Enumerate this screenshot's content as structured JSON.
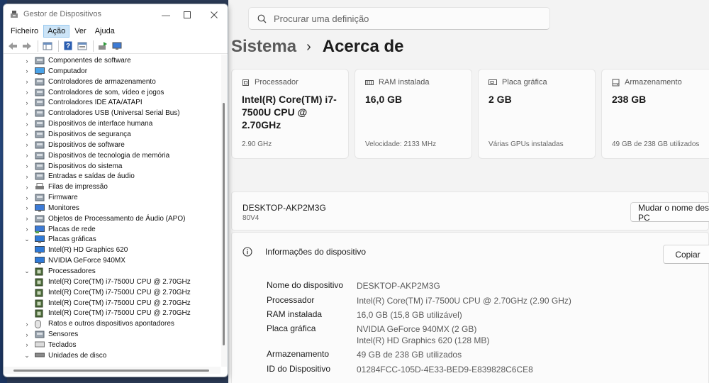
{
  "device_manager": {
    "title": "Gestor de Dispositivos",
    "menu": [
      "Ficheiro",
      "Ação",
      "Ver",
      "Ajuda"
    ],
    "tree": [
      {
        "label": "Componentes de software",
        "level": 0,
        "expanded": false,
        "icon": "software-component-icon"
      },
      {
        "label": "Computador",
        "level": 0,
        "expanded": false,
        "icon": "computer-icon"
      },
      {
        "label": "Controladores de armazenamento",
        "level": 0,
        "expanded": false,
        "icon": "storage-controller-icon"
      },
      {
        "label": "Controladores de som, vídeo e jogos",
        "level": 0,
        "expanded": false,
        "icon": "speaker-icon"
      },
      {
        "label": "Controladores IDE ATA/ATAPI",
        "level": 0,
        "expanded": false,
        "icon": "ide-controller-icon"
      },
      {
        "label": "Controladores USB (Universal Serial Bus)",
        "level": 0,
        "expanded": false,
        "icon": "usb-icon"
      },
      {
        "label": "Dispositivos de interface humana",
        "level": 0,
        "expanded": false,
        "icon": "hid-icon"
      },
      {
        "label": "Dispositivos de segurança",
        "level": 0,
        "expanded": false,
        "icon": "security-device-icon"
      },
      {
        "label": "Dispositivos de software",
        "level": 0,
        "expanded": false,
        "icon": "software-device-icon"
      },
      {
        "label": "Dispositivos de tecnologia de memória",
        "level": 0,
        "expanded": false,
        "icon": "memory-icon"
      },
      {
        "label": "Dispositivos do sistema",
        "level": 0,
        "expanded": false,
        "icon": "system-folder-icon"
      },
      {
        "label": "Entradas e saídas de áudio",
        "level": 0,
        "expanded": false,
        "icon": "audio-io-icon"
      },
      {
        "label": "Filas de impressão",
        "level": 0,
        "expanded": false,
        "icon": "printer-icon"
      },
      {
        "label": "Firmware",
        "level": 0,
        "expanded": false,
        "icon": "firmware-icon"
      },
      {
        "label": "Monitores",
        "level": 0,
        "expanded": false,
        "icon": "monitor-icon"
      },
      {
        "label": "Objetos de Processamento de Áudio (APO)",
        "level": 0,
        "expanded": false,
        "icon": "audio-processing-icon"
      },
      {
        "label": "Placas de rede",
        "level": 0,
        "expanded": false,
        "icon": "network-adapter-icon"
      },
      {
        "label": "Placas gráficas",
        "level": 0,
        "expanded": true,
        "icon": "display-adapter-icon"
      },
      {
        "label": "Intel(R) HD Graphics 620",
        "level": 1,
        "icon": "display-adapter-icon"
      },
      {
        "label": "NVIDIA GeForce 940MX",
        "level": 1,
        "icon": "display-adapter-icon"
      },
      {
        "label": "Processadores",
        "level": 0,
        "expanded": true,
        "icon": "processor-icon"
      },
      {
        "label": "Intel(R) Core(TM) i7-7500U CPU @ 2.70GHz",
        "level": 1,
        "icon": "processor-icon"
      },
      {
        "label": "Intel(R) Core(TM) i7-7500U CPU @ 2.70GHz",
        "level": 1,
        "icon": "processor-icon"
      },
      {
        "label": "Intel(R) Core(TM) i7-7500U CPU @ 2.70GHz",
        "level": 1,
        "icon": "processor-icon"
      },
      {
        "label": "Intel(R) Core(TM) i7-7500U CPU @ 2.70GHz",
        "level": 1,
        "icon": "processor-icon"
      },
      {
        "label": "Ratos e outros dispositivos apontadores",
        "level": 0,
        "expanded": false,
        "icon": "mouse-icon"
      },
      {
        "label": "Sensores",
        "level": 0,
        "expanded": false,
        "icon": "sensor-icon"
      },
      {
        "label": "Teclados",
        "level": 0,
        "expanded": false,
        "icon": "keyboard-icon"
      },
      {
        "label": "Unidades de disco",
        "level": 0,
        "expanded": true,
        "icon": "disk-drive-icon"
      }
    ]
  },
  "settings": {
    "search": {
      "placeholder": "Procurar uma definição"
    },
    "breadcrumb": {
      "parent": "Sistema",
      "current": "Acerca de"
    },
    "cards": [
      {
        "label": "Processador",
        "value": "Intel(R) Core(TM) i7-7500U CPU @ 2.70GHz",
        "sub": "2.90 GHz",
        "icon": "processor-icon"
      },
      {
        "label": "RAM instalada",
        "value": "16,0 GB",
        "sub": "Velocidade: 2133 MHz",
        "icon": "ram-icon"
      },
      {
        "label": "Placa gráfica",
        "value": "2 GB",
        "sub": "Várias GPUs instaladas",
        "icon": "gpu-icon"
      },
      {
        "label": "Armazenamento",
        "value": "238 GB",
        "sub": "49 GB de 238 GB utilizados",
        "icon": "storage-icon"
      }
    ],
    "device": {
      "name": "DESKTOP-AKP2M3G",
      "model": "80V4",
      "rename_label": "Mudar o nome deste PC"
    },
    "info": {
      "title": "Informações do dispositivo",
      "copy_label": "Copiar",
      "specs": [
        {
          "key": "Nome do dispositivo",
          "value": "DESKTOP-AKP2M3G"
        },
        {
          "key": "Processador",
          "value": "Intel(R) Core(TM) i7-7500U CPU @ 2.70GHz (2.90 GHz)"
        },
        {
          "key": "RAM instalada",
          "value": "16,0 GB (15,8 GB utilizável)"
        },
        {
          "key": "Placa gráfica",
          "value": "NVIDIA GeForce 940MX (2 GB)",
          "value2": "Intel(R) HD Graphics 620 (128 MB)"
        },
        {
          "key": "Armazenamento",
          "value": "49 GB de 238 GB utilizados"
        },
        {
          "key": "ID do Dispositivo",
          "value": "01284FCC-105D-4E33-BED9-E839828C6CE8"
        }
      ]
    }
  }
}
